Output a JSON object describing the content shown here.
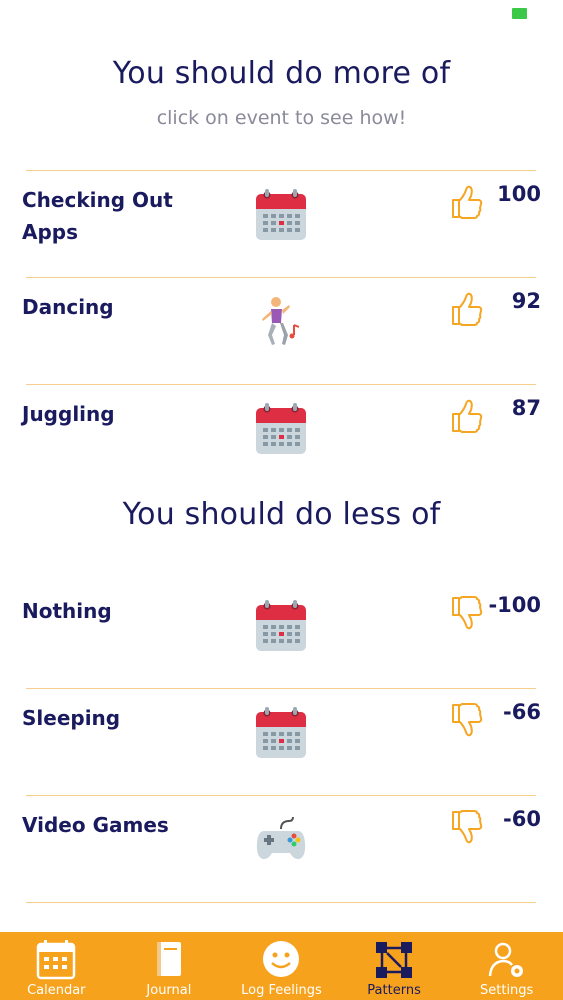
{
  "status_bar": {
    "battery_color": "#3cc94a"
  },
  "more_section": {
    "title": "You should do more of",
    "subtitle": "click on event to see how!",
    "items": [
      {
        "label": "Checking Out Apps",
        "icon": "calendar-icon",
        "thumb": "thumbs-up-icon",
        "score": "100"
      },
      {
        "label": "Dancing",
        "icon": "dancer-icon",
        "thumb": "thumbs-up-icon",
        "score": "92"
      },
      {
        "label": "Juggling",
        "icon": "calendar-icon",
        "thumb": "thumbs-up-icon",
        "score": "87"
      }
    ]
  },
  "less_section": {
    "title": "You should do less of",
    "items": [
      {
        "label": "Nothing",
        "icon": "calendar-icon",
        "thumb": "thumbs-down-icon",
        "score": "-100"
      },
      {
        "label": "Sleeping",
        "icon": "calendar-icon",
        "thumb": "thumbs-down-icon",
        "score": "-66"
      },
      {
        "label": "Video Games",
        "icon": "game-controller-icon",
        "thumb": "thumbs-down-icon",
        "score": "-60"
      }
    ]
  },
  "tab_bar": {
    "background": "#f7a21c",
    "tabs": [
      {
        "label": "Calendar",
        "icon": "calendar-icon",
        "active": false
      },
      {
        "label": "Journal",
        "icon": "book-icon",
        "active": false
      },
      {
        "label": "Log Feelings",
        "icon": "smiley-icon",
        "active": false
      },
      {
        "label": "Patterns",
        "icon": "patterns-icon",
        "active": true
      },
      {
        "label": "Settings",
        "icon": "user-settings-icon",
        "active": false
      }
    ]
  },
  "colors": {
    "text": "#1a1a5e",
    "accent": "#f7a21c",
    "divider": "#f6cf8f"
  }
}
